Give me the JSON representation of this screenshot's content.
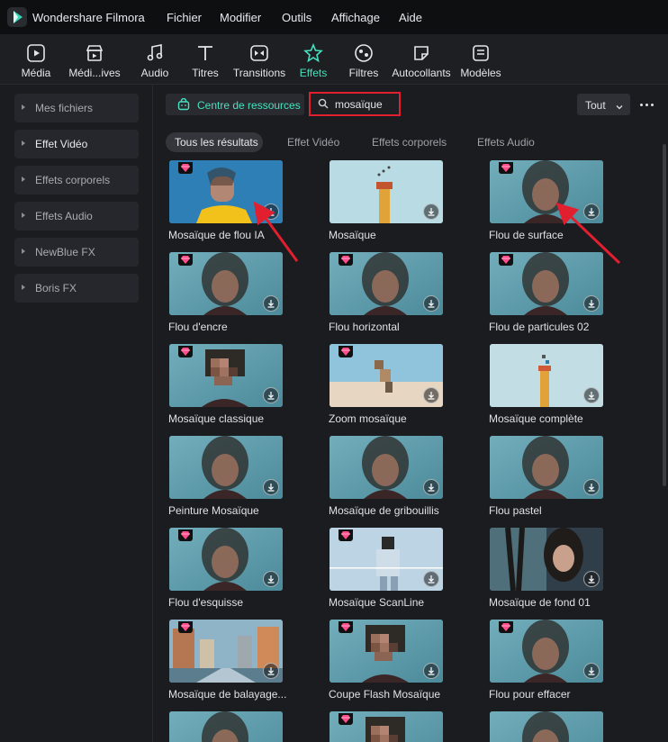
{
  "app": {
    "name": "Wondershare Filmora"
  },
  "menu": [
    "Fichier",
    "Modifier",
    "Outils",
    "Affichage",
    "Aide"
  ],
  "toolbar": [
    {
      "label": "Média",
      "icon": "media-icon"
    },
    {
      "label": "Médi...ives",
      "icon": "stock-media-icon"
    },
    {
      "label": "Audio",
      "icon": "audio-note-icon"
    },
    {
      "label": "Titres",
      "icon": "titles-icon"
    },
    {
      "label": "Transitions",
      "icon": "transitions-icon"
    },
    {
      "label": "Effets",
      "icon": "effects-icon",
      "active": true
    },
    {
      "label": "Filtres",
      "icon": "filters-icon"
    },
    {
      "label": "Autocollants",
      "icon": "stickers-icon"
    },
    {
      "label": "Modèles",
      "icon": "templates-icon"
    }
  ],
  "sidebar": {
    "items": [
      {
        "label": "Mes fichiers"
      },
      {
        "label": "Effet Vidéo",
        "active": true
      },
      {
        "label": "Effets corporels"
      },
      {
        "label": "Effets Audio"
      },
      {
        "label": "NewBlue FX"
      },
      {
        "label": "Boris FX"
      }
    ]
  },
  "resource_center": {
    "label": "Centre de ressources"
  },
  "search": {
    "value": "mosaïque"
  },
  "filter": {
    "selected": "Tout"
  },
  "tabs": [
    {
      "label": "Tous les résultats",
      "active": true
    },
    {
      "label": "Effet Vidéo"
    },
    {
      "label": "Effets corporels"
    },
    {
      "label": "Effets Audio"
    }
  ],
  "effects": [
    {
      "label": "Mosaïque de flou IA",
      "premium": true,
      "thumb": "person-yellow"
    },
    {
      "label": "Mosaïque",
      "premium": false,
      "thumb": "lighthouse"
    },
    {
      "label": "Flou de surface",
      "premium": true,
      "thumb": "blur-face"
    },
    {
      "label": "Flou d'encre",
      "premium": true,
      "thumb": "blur-face"
    },
    {
      "label": "Flou horizontal",
      "premium": true,
      "thumb": "blur-face"
    },
    {
      "label": "Flou de particules 02",
      "premium": true,
      "thumb": "blur-face"
    },
    {
      "label": "Mosaïque classique",
      "premium": true,
      "thumb": "pixel-face"
    },
    {
      "label": "Zoom mosaïque",
      "premium": true,
      "thumb": "beach"
    },
    {
      "label": "Mosaïque complète",
      "premium": false,
      "thumb": "pixel-lighthouse"
    },
    {
      "label": "Peinture Mosaïque",
      "premium": false,
      "thumb": "blur-face"
    },
    {
      "label": "Mosaïque de gribouillis",
      "premium": false,
      "thumb": "blur-face"
    },
    {
      "label": "Flou pastel",
      "premium": false,
      "thumb": "blur-face"
    },
    {
      "label": "Flou d'esquisse",
      "premium": true,
      "thumb": "blur-face"
    },
    {
      "label": "Mosaïque ScanLine",
      "premium": true,
      "thumb": "scanline"
    },
    {
      "label": "Mosaïque de fond 01",
      "premium": false,
      "thumb": "split-face"
    },
    {
      "label": "Mosaïque de balayage...",
      "premium": true,
      "thumb": "city"
    },
    {
      "label": "Coupe Flash Mosaïque",
      "premium": true,
      "thumb": "pixel-face"
    },
    {
      "label": "Flou pour effacer",
      "premium": true,
      "thumb": "blur-face"
    },
    {
      "label": "",
      "premium": false,
      "thumb": "blur-face"
    },
    {
      "label": "",
      "premium": true,
      "thumb": "pixel-face"
    },
    {
      "label": "",
      "premium": false,
      "thumb": "blur-face"
    }
  ],
  "colors": {
    "accent": "#46e1bf",
    "highlight": "#e11f2f",
    "premium": "#ff4d8d"
  }
}
